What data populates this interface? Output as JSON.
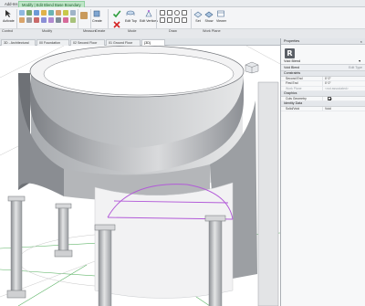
{
  "ribbon": {
    "tabs": [
      {
        "label": "Add-Ins"
      },
      {
        "label": "Modify | Edit Blend Base Boundary"
      }
    ],
    "buttons": {
      "activate": "Activate",
      "create": "Create",
      "mode_edit_top": "Edit Top",
      "mode_edit_vertices": "Edit Vertices",
      "set": "Set",
      "show": "Show",
      "viewer": "Viewer"
    },
    "panels": {
      "control": "Control",
      "modify": "Modify",
      "measure": "Measure",
      "create": "Create",
      "mode": "Mode",
      "draw": "Draw",
      "work_plane": "Work Plane"
    },
    "colors": {
      "contextual_tab": "#bfe6c8",
      "finish_edit": "#2e9e3e",
      "cancel_edit": "#d32020"
    }
  },
  "view_tabs": [
    {
      "label": "3D - Architectural"
    },
    {
      "label": "00 Foundation"
    },
    {
      "label": "02 Second Floor"
    },
    {
      "label": "01 Ground Floor"
    },
    {
      "label": "{3D}"
    }
  ],
  "viewport": {
    "colors": {
      "wall": "#9b9ea2",
      "sketch": "#b25ad8",
      "grid": "#3fa64a"
    }
  },
  "properties": {
    "title": "Properties",
    "close": "×",
    "type_icon_letter": "R",
    "type_name": "Void Blend",
    "filter": "Void Blend",
    "edit_type": "Edit Type",
    "groups": {
      "constraints": "Constraints",
      "graphics": "Graphics",
      "identity": "Identity Data"
    },
    "rows": {
      "second_end": {
        "name": "Second End",
        "value": "0'  0\""
      },
      "first_end": {
        "name": "First End",
        "value": "0'  0\""
      },
      "work_plane": {
        "name": "Work Plane",
        "value": "<not associated>"
      },
      "cuts_geometry": {
        "name": "Cuts Geometry",
        "value": "checked"
      },
      "solid_void": {
        "name": "Solid/Void",
        "value": "Void"
      }
    }
  }
}
